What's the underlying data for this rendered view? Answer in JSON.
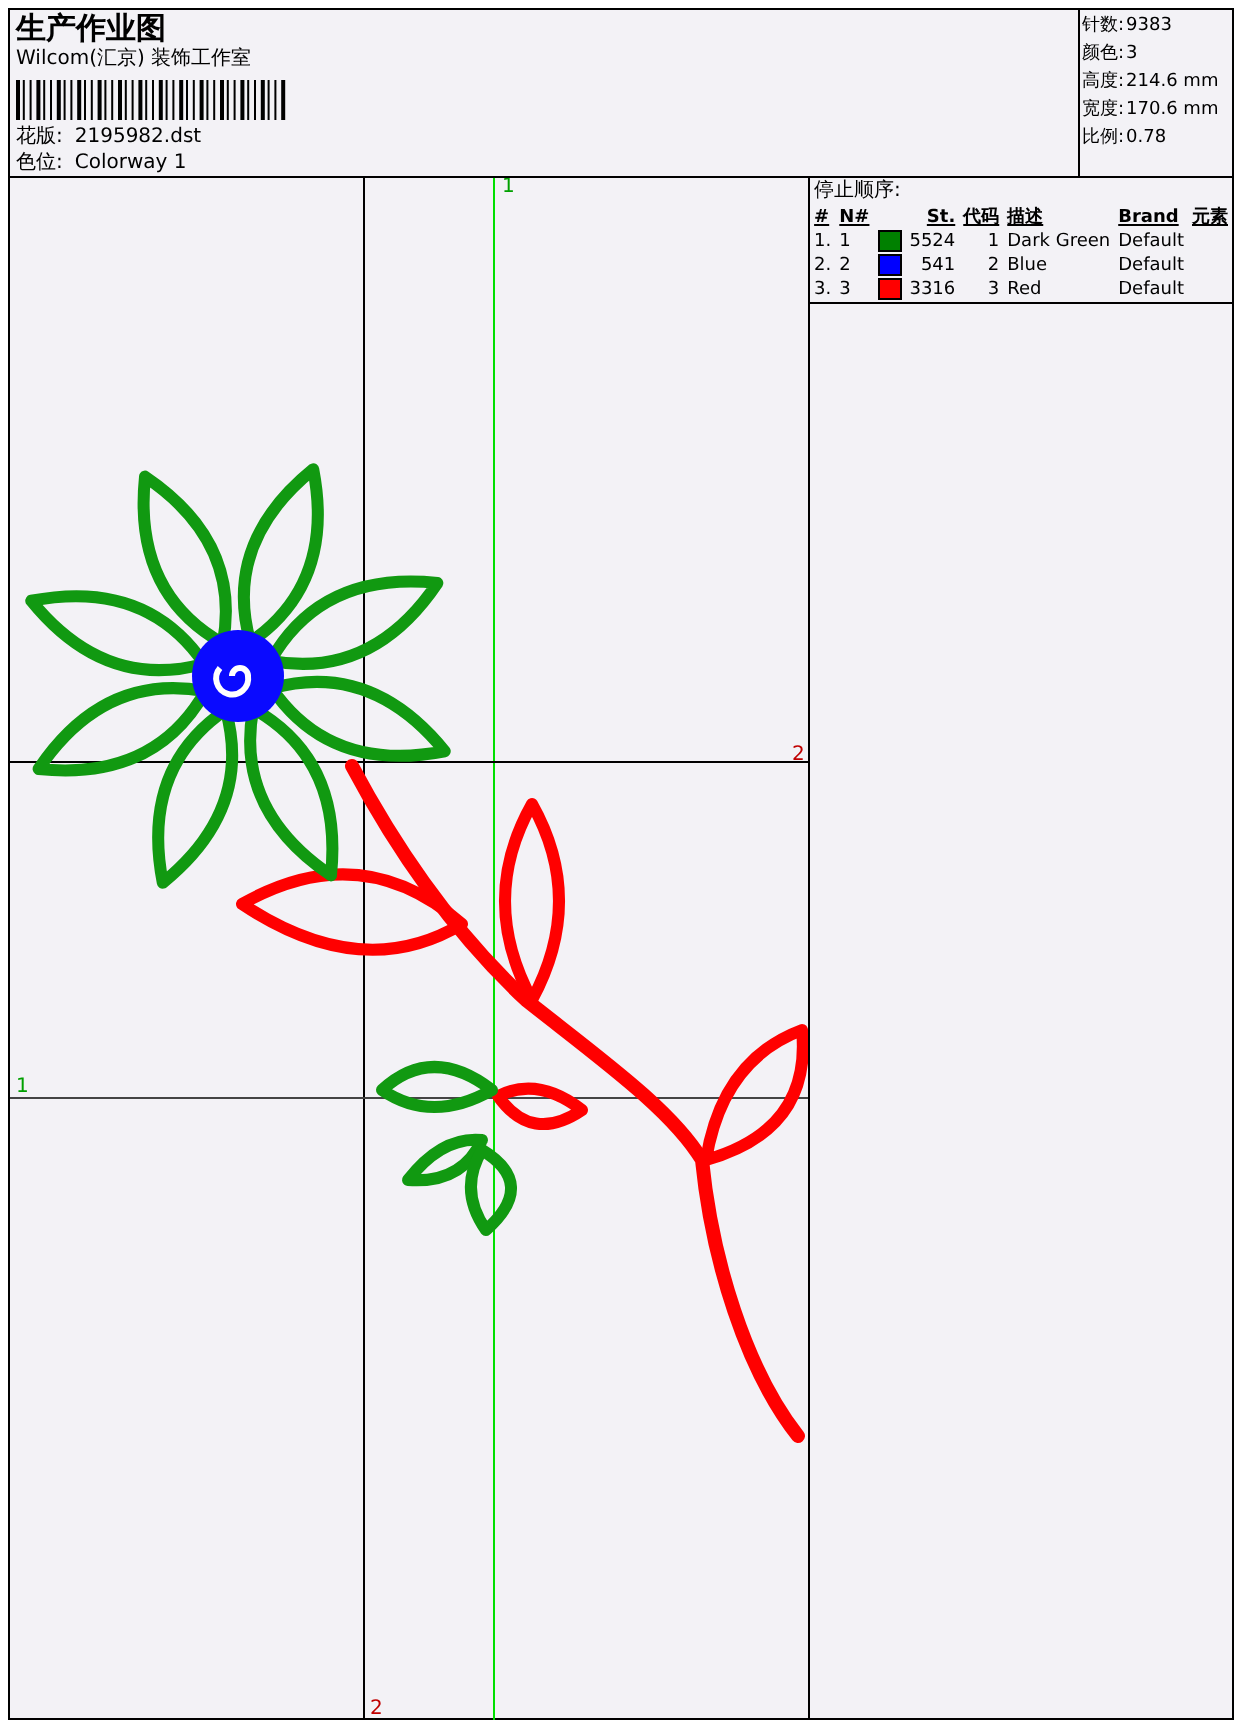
{
  "header": {
    "title": "生产作业图",
    "company": "Wilcom(汇京) 装饰工作室",
    "fields": [
      {
        "label": "花版:",
        "value": "2195982.dst"
      },
      {
        "label": "色位:",
        "value": "Colorway 1"
      }
    ]
  },
  "stats": [
    {
      "label": "针数:",
      "value": "9383"
    },
    {
      "label": "颜色:",
      "value": "3"
    },
    {
      "label": "高度:",
      "value": "214.6 mm"
    },
    {
      "label": "宽度:",
      "value": "170.6 mm"
    },
    {
      "label": "比例:",
      "value": "0.78"
    }
  ],
  "canvas": {
    "guide_labels": [
      "1",
      "2",
      "1",
      "2"
    ]
  },
  "stop_sequence": {
    "title": "停止顺序:",
    "columns": [
      "#",
      "N#",
      "St.",
      "代码",
      "描述",
      "Brand",
      "元素"
    ],
    "rows": [
      {
        "index": "1.",
        "number": "1",
        "color": "#008000",
        "stitches": "5524",
        "code": "1",
        "description": "Dark Green",
        "brand": "Default"
      },
      {
        "index": "2.",
        "number": "2",
        "color": "#0000ff",
        "stitches": "541",
        "code": "2",
        "description": "Blue",
        "brand": "Default"
      },
      {
        "index": "3.",
        "number": "3",
        "color": "#ff0000",
        "stitches": "3316",
        "code": "3",
        "description": "Red",
        "brand": "Default"
      }
    ]
  }
}
